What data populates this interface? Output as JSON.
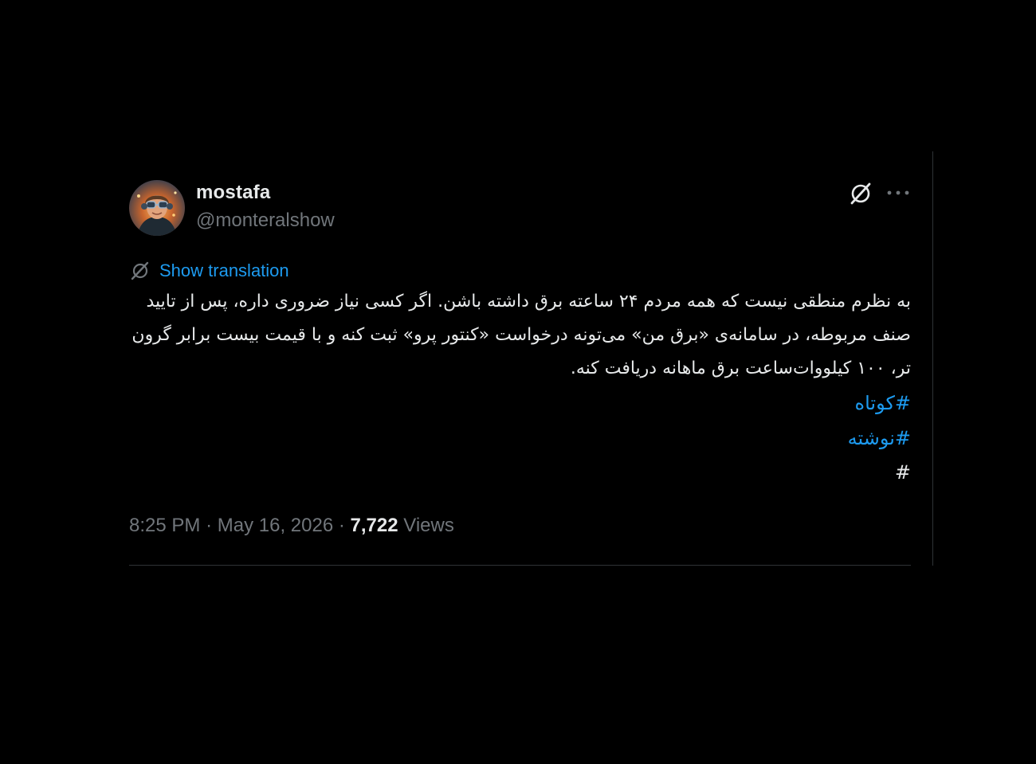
{
  "author": {
    "display_name": "mostafa",
    "handle": "@monteralshow",
    "avatar_icon": "avatar-icon"
  },
  "actions": {
    "grok_icon": "grok-icon",
    "more_icon": "more-options-icon"
  },
  "translation": {
    "label": "Show translation",
    "icon": "grok-icon"
  },
  "tweet": {
    "lines": [
      "به نظرم منطقی نیست که همه مردم ۲۴ ساعته برق داشته باشن. اگر کسی نیاز ضروری داره، پس از تایید صنف مربوطه، در سامانه‌ی «برق من» می‌تونه درخواست «کنتور پرو» ثبت کنه و با قیمت بیست برابر گرون تر، ۱۰۰ کیلووات‌ساعت برق ماهانه دریافت کنه."
    ],
    "hashtags": [
      "#کوتاه",
      "#نوشته"
    ],
    "trailing": "#"
  },
  "meta": {
    "time": "8:25 PM",
    "separator": "·",
    "date": "May 16, 2026",
    "views_count": "7,722",
    "views_label": "Views"
  },
  "colors": {
    "background": "#000000",
    "text": "#e7e9ea",
    "muted": "#71767b",
    "accent": "#1d9bf0",
    "divider": "#2f3336"
  }
}
